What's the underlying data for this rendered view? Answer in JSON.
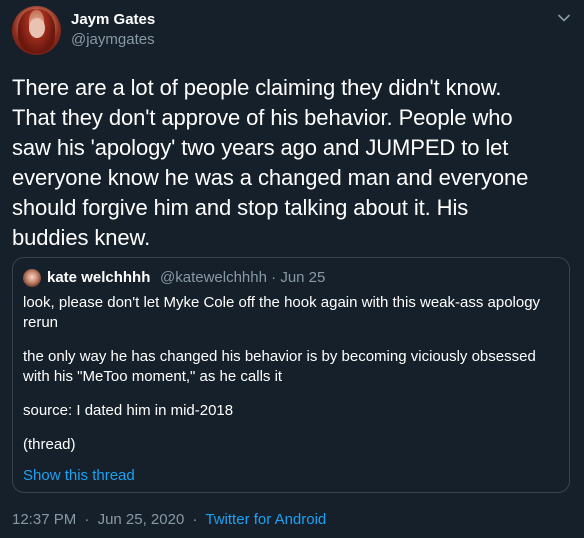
{
  "tweet": {
    "author_name": "Jaym Gates",
    "author_handle": "@jaymgates",
    "text": "There are a lot of people claiming they didn't know.\nThat they don't approve of his behavior. People who\nsaw his 'apology' two years ago and JUMPED to let\neveryone know he was a changed man and everyone\nshould forgive him and stop talking about it. His\nbuddies knew.",
    "time": "12:37 PM",
    "date": "Jun 25, 2020",
    "separator": "·",
    "source": "Twitter for Android",
    "menu_icon": "chevron-down-icon"
  },
  "quoted": {
    "author_name": "kate welchhhh",
    "author_handle": "@katewelchhhh",
    "date": "Jun 25",
    "separator": "·",
    "paragraphs": [
      "look, please don't let Myke Cole off the hook again with this weak-ass apology rerun",
      "the only way he has changed his behavior is by becoming viciously obsessed with his \"MeToo moment,\" as he calls it",
      "source: I dated him in mid-2018",
      "(thread)"
    ],
    "show_thread": "Show this thread"
  },
  "colors": {
    "background": "#15202b",
    "text": "#ffffff",
    "secondary": "#8899a6",
    "link": "#1da1f2",
    "border": "#38444d"
  }
}
